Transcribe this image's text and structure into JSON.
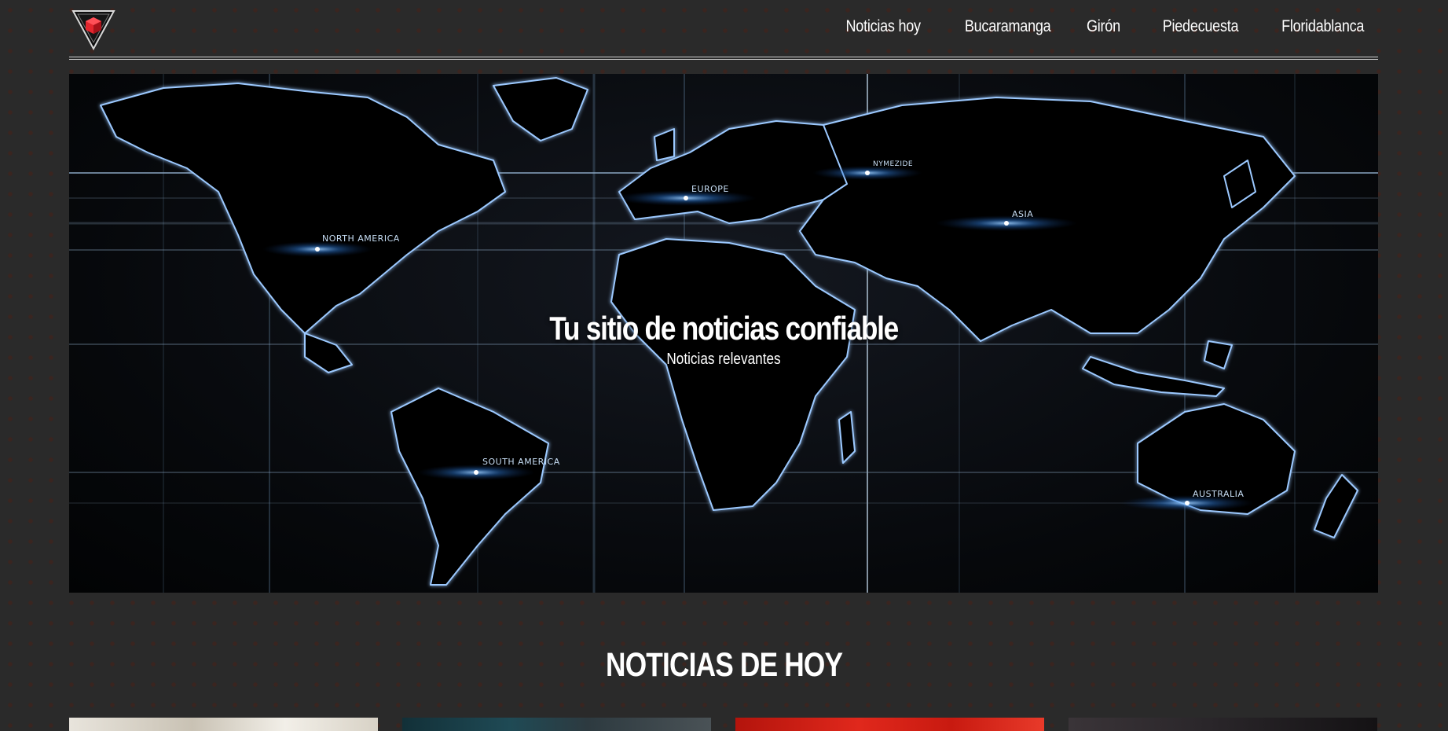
{
  "site": {
    "logo_icon": "triangle-cube-logo-icon"
  },
  "nav": {
    "items": [
      "Noticias hoy",
      "Bucaramanga",
      "Girón",
      "Piedecuesta",
      "Floridablanca"
    ]
  },
  "hero": {
    "title": "Tu sitio de noticias confiable",
    "subtitle": "Noticias relevantes",
    "map_labels": [
      "NORTH AMERICA",
      "EUROPE",
      "NYMEZIDE",
      "ASIA",
      "SOUTH AMERICA",
      "AUSTRALIA"
    ]
  },
  "section": {
    "title": "NOTICIAS DE HOY"
  },
  "colors": {
    "background": "#2a2a2a",
    "accent": "#e3262e",
    "map_glow": "#3b8fe8"
  }
}
